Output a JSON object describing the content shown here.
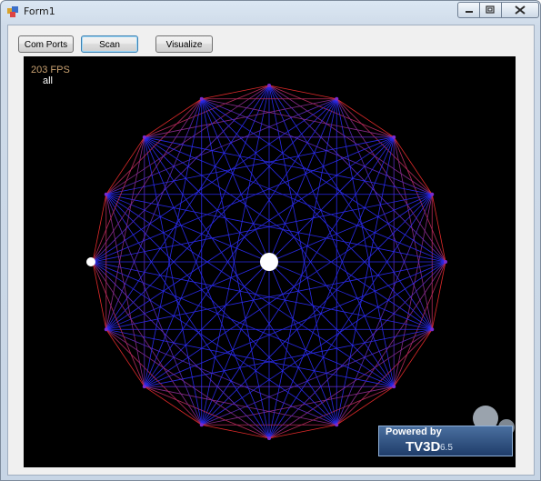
{
  "window": {
    "title": "Form1",
    "buttons": [
      "minimize",
      "maximize",
      "close"
    ]
  },
  "toolbar": {
    "com_ports_label": "Com Ports",
    "scan_label": "Scan",
    "visualize_label": "Visualize"
  },
  "viewport": {
    "fps_text": "203 FPS",
    "mode_text": "all",
    "graph": {
      "node_count": 16,
      "outer_edge_color": "#e02a2a",
      "inner_edge_color": "#2a2ae8",
      "background": "#000000",
      "marker_color": "#ffffff"
    },
    "logo": {
      "line1": "Powered by",
      "line2": "TV3D",
      "version": "6.5"
    }
  }
}
